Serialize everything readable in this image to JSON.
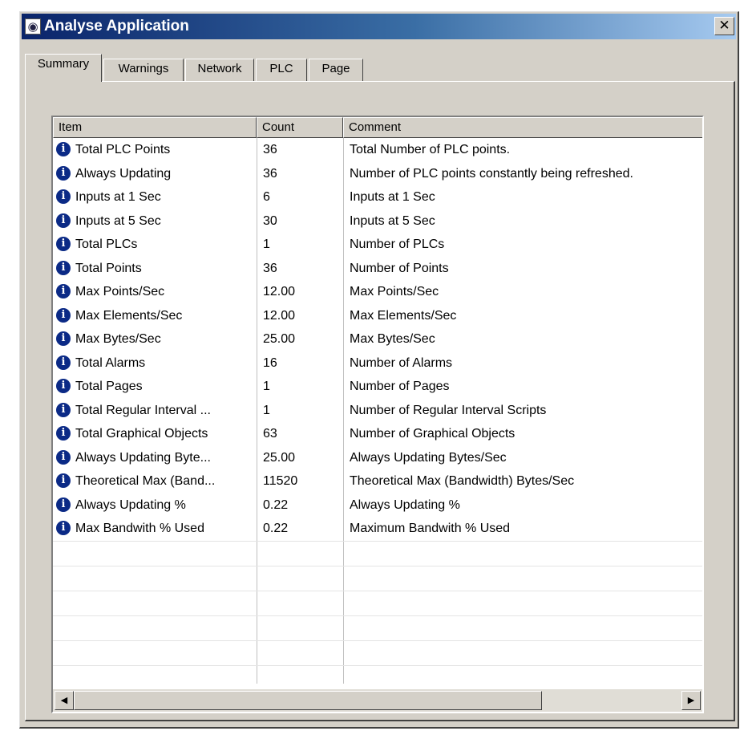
{
  "window": {
    "title": "Analyse Application",
    "close_label": "✕",
    "icon": "app-icon"
  },
  "tabs": [
    {
      "label": "Summary",
      "active": true
    },
    {
      "label": "Warnings",
      "active": false
    },
    {
      "label": "Network",
      "active": false
    },
    {
      "label": "PLC",
      "active": false
    },
    {
      "label": "Page",
      "active": false
    }
  ],
  "table": {
    "columns": [
      "Item",
      "Count",
      "Comment"
    ],
    "row_icon": "info-icon",
    "rows": [
      {
        "item": "Total PLC Points",
        "count": "36",
        "comment": "Total Number of PLC points."
      },
      {
        "item": "Always Updating",
        "count": "36",
        "comment": "Number of PLC points constantly being refreshed."
      },
      {
        "item": "Inputs at 1 Sec",
        "count": "6",
        "comment": "Inputs at 1 Sec"
      },
      {
        "item": "Inputs at 5 Sec",
        "count": "30",
        "comment": "Inputs at 5 Sec"
      },
      {
        "item": "Total PLCs",
        "count": "1",
        "comment": "Number of PLCs"
      },
      {
        "item": "Total Points",
        "count": "36",
        "comment": "Number of Points"
      },
      {
        "item": "Max Points/Sec",
        "count": "12.00",
        "comment": "Max Points/Sec"
      },
      {
        "item": "Max Elements/Sec",
        "count": "12.00",
        "comment": "Max Elements/Sec"
      },
      {
        "item": "Max Bytes/Sec",
        "count": "25.00",
        "comment": "Max Bytes/Sec"
      },
      {
        "item": "Total Alarms",
        "count": "16",
        "comment": "Number of Alarms"
      },
      {
        "item": "Total Pages",
        "count": "1",
        "comment": "Number of Pages"
      },
      {
        "item": "Total Regular Interval ...",
        "count": "1",
        "comment": "Number of Regular Interval Scripts"
      },
      {
        "item": "Total Graphical Objects",
        "count": "63",
        "comment": "Number of Graphical Objects"
      },
      {
        "item": "Always Updating Byte...",
        "count": "25.00",
        "comment": "Always Updating Bytes/Sec"
      },
      {
        "item": "Theoretical Max (Band...",
        "count": "11520",
        "comment": "Theoretical Max (Bandwidth) Bytes/Sec"
      },
      {
        "item": "Always Updating %",
        "count": "0.22",
        "comment": "Always Updating %"
      },
      {
        "item": "Max Bandwith % Used",
        "count": "0.22",
        "comment": "Maximum Bandwith % Used"
      }
    ]
  },
  "scrollbar": {
    "left_arrow": "◀",
    "right_arrow": "▶"
  }
}
